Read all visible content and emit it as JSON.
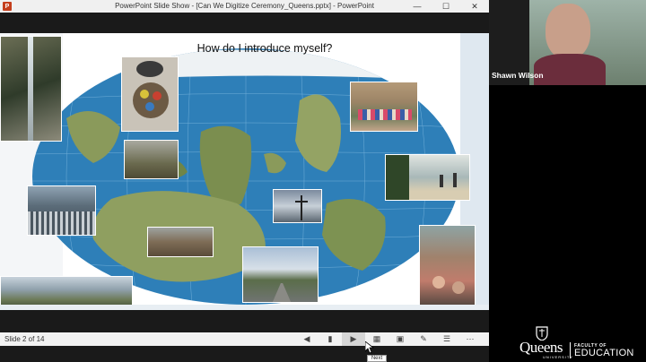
{
  "window": {
    "title": "PowerPoint Slide Show - [Can We Digitize Ceremony_Queens.pptx] - PowerPoint",
    "app_icon": "powerpoint-icon",
    "controls": [
      "minimize",
      "maximize",
      "close"
    ]
  },
  "slide": {
    "title": "How do I introduce myself?",
    "background_map": "upside-down-world-map"
  },
  "statusbar": {
    "slide_indicator": "Slide 2 of 14",
    "icons": [
      "previous-icon",
      "slide-list-icon",
      "next-icon",
      "grid-icon",
      "display-icon",
      "pen-icon",
      "reading-icon",
      "more-icon"
    ]
  },
  "tooltip": {
    "text": "Next"
  },
  "video": {
    "participant_name": "Shawn Wilson"
  },
  "logo": {
    "university": "Queens",
    "university_sub": "UNIVERSITY",
    "faculty_line1": "FACULTY OF",
    "faculty_line2": "EDUCATION"
  },
  "colors": {
    "ocean": "#2e7fb8",
    "land": "#8a9a5b",
    "accent": "#c43e1c"
  }
}
